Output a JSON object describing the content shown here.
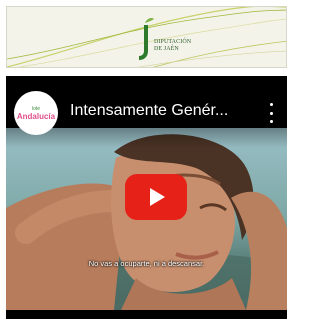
{
  "banner": {
    "org_line1": "DIPUTACIÓN",
    "org_line2": "DE JAÉN",
    "accent_color": "#2d7a2a"
  },
  "video": {
    "channel_avatar": {
      "top_text": "lote",
      "main_text": "Andalucía"
    },
    "title": "Intensamente Genér...",
    "menu_icon": "more-vert-icon",
    "play_icon": "youtube-play-icon",
    "play_color": "#e62117",
    "subtitle": "No vas a ocuparte, ni a descansar."
  }
}
